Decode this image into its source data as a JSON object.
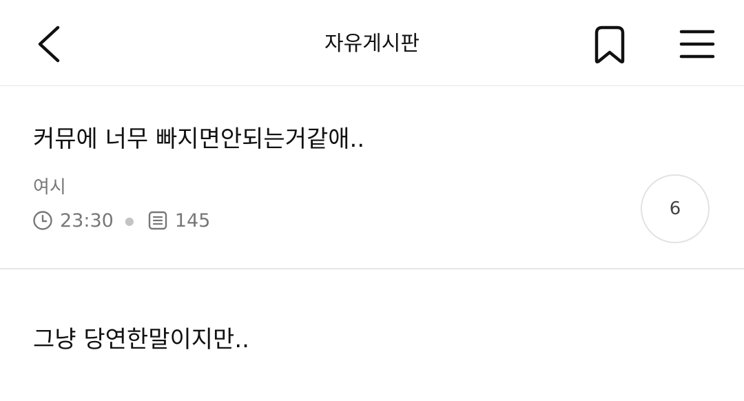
{
  "header": {
    "title": "자유게시판",
    "back_icon": "chevron-left-icon",
    "bookmark_icon": "bookmark-icon",
    "menu_icon": "hamburger-menu-icon"
  },
  "post": {
    "title": "커뮤에 너무 빠지면안되는거같애..",
    "author": "여시",
    "time": "23:30",
    "views": "145",
    "comment_count": "6",
    "body_first_line": "그냥 당연한말이지만.."
  }
}
